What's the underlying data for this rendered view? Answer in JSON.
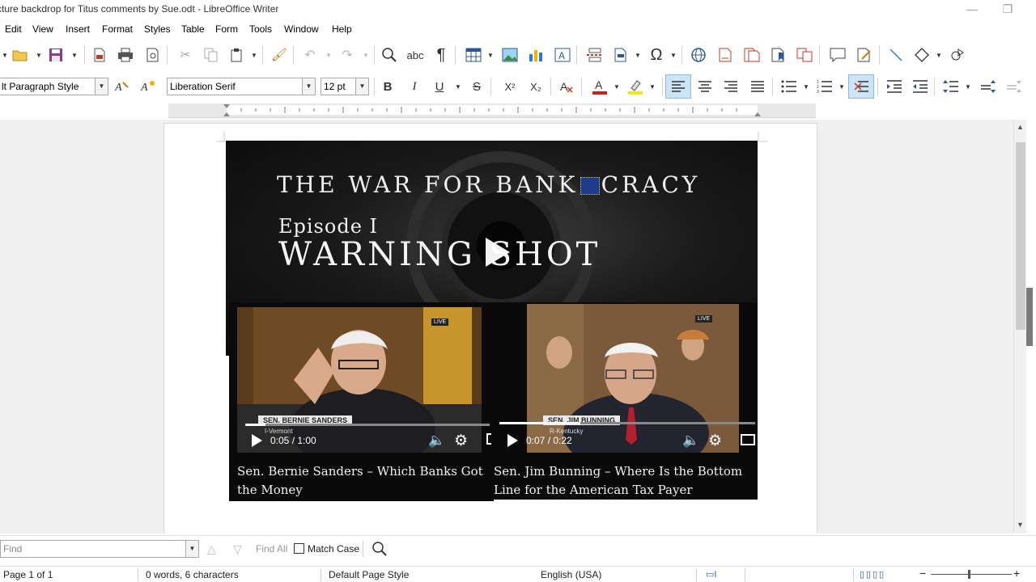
{
  "window": {
    "title": "cture backdrop for Titus comments by Sue.odt - LibreOffice Writer",
    "minimize": "—",
    "restore": "❐"
  },
  "menu": [
    "Edit",
    "View",
    "Insert",
    "Format",
    "Styles",
    "Table",
    "Form",
    "Tools",
    "Window",
    "Help"
  ],
  "formatting": {
    "paragraph_style": "lt Paragraph Style",
    "font_name": "Liberation Serif",
    "font_size": "12 pt",
    "bold": "B",
    "italic": "I",
    "underline": "U",
    "strike": "S",
    "superscript": "X²",
    "subscript": "X₂"
  },
  "document": {
    "hero": {
      "title_left": "THE WAR FOR BANK",
      "title_right": "CRACY",
      "episode": "Episode I",
      "subtitle": "WARNING SHOT"
    },
    "videos": [
      {
        "lower_third": "SEN. BERNIE SANDERS",
        "lower_sub": "I-Vermont",
        "live": "LIVE",
        "time": "0:05 / 1:00",
        "progress": 0.083,
        "caption": "Sen. Bernie Sanders – Which Banks Got the Money"
      },
      {
        "lower_third": "SEN. JIM BUNNING",
        "lower_sub": "R-Kentucky",
        "live": "LIVE",
        "time": "0:07 / 0:22",
        "progress": 0.318,
        "caption": "Sen. Jim Bunning – Where Is the Bottom Line for the American Tax Payer"
      }
    ]
  },
  "find": {
    "placeholder": "Find",
    "find_all": "Find All",
    "match_case": "Match Case"
  },
  "status": {
    "page": "Page 1 of 1",
    "words": "0 words, 6 characters",
    "page_style": "Default Page Style",
    "language": "English (USA)"
  }
}
